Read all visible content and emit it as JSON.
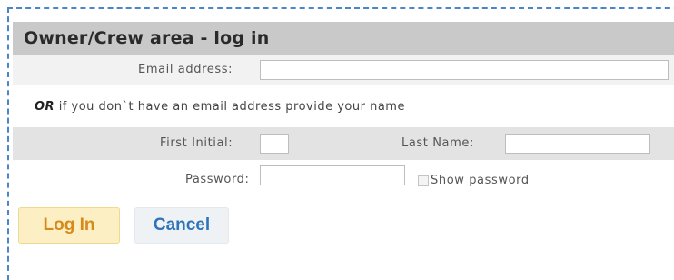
{
  "form": {
    "title": "Owner/Crew area - log in",
    "email": {
      "label": "Email address:",
      "value": "",
      "placeholder": ""
    },
    "or_line": {
      "emphasis": "OR",
      "text": " if you don`t have an email address provide your name"
    },
    "first_initial": {
      "label": "First Initial:",
      "value": ""
    },
    "last_name": {
      "label": "Last Name:",
      "value": ""
    },
    "password": {
      "label": "Password:",
      "value": ""
    },
    "show_password": {
      "label": "Show password",
      "checked": false
    },
    "login_button": "Log In",
    "cancel_button": "Cancel"
  },
  "colors": {
    "frame_border": "#4a86c5",
    "title_bar": "#c9c9c9",
    "login_text": "#d58a1a",
    "login_bg": "#fdefc4",
    "cancel_text": "#2f73b8",
    "cancel_bg": "#eef2f5"
  }
}
